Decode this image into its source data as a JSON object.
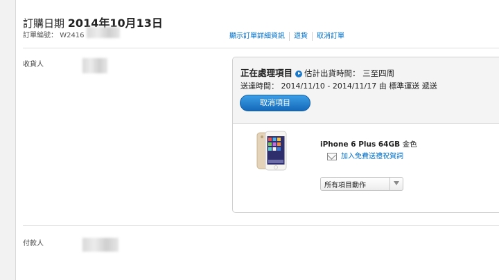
{
  "order": {
    "title_prefix": "訂購日期",
    "date": "2014年10月13日",
    "number_label": "訂單編號：",
    "number_visible": "W2416"
  },
  "links": {
    "show_details": "顯示訂單詳細資訊",
    "returns": "退貨",
    "cancel_order": "取消訂單"
  },
  "recipient": {
    "label": "收貨人"
  },
  "payer": {
    "label": "付款人"
  },
  "shipment": {
    "status": "正在處理項目",
    "estimate_label": "估計出貨時間：",
    "estimate_value": "三至四周",
    "delivery_label": "送達時間：",
    "delivery_value": "2014/11/10 - 2014/11/17 由 標準運送 遞送",
    "cancel_item_button": "取消項目"
  },
  "item": {
    "name": "iPhone 6 Plus 64GB",
    "color": "金色",
    "gift_message_link": "加入免費送禮祝賀詞",
    "actions_select": "所有項目動作"
  },
  "icons": {
    "info": "info-play-icon",
    "gift": "envelope-icon",
    "dropdown": "chevron-down-icon"
  },
  "colors": {
    "link": "#0070c9",
    "button": "#1a78c8"
  }
}
